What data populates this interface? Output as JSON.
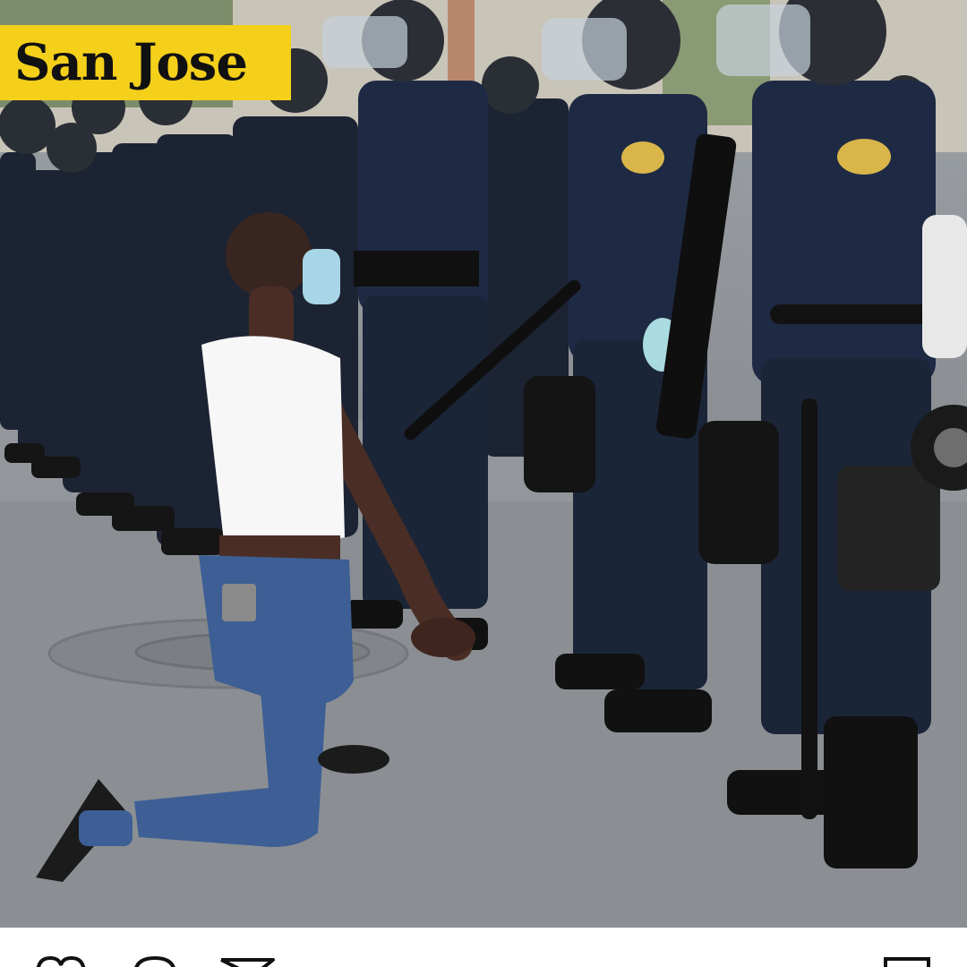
{
  "post": {
    "location_tag": "San Jose",
    "colors": {
      "tag_background": "#f4d01b",
      "tag_text": "#111111",
      "police_uniform": "#1e2a44",
      "protester_top": "#f7f7f7",
      "protester_jeans": "#3d5f95",
      "road": "#8b8f93"
    }
  },
  "action_bar": {
    "icons": [
      "heart-icon",
      "comment-icon",
      "share-icon",
      "bookmark-icon"
    ]
  }
}
